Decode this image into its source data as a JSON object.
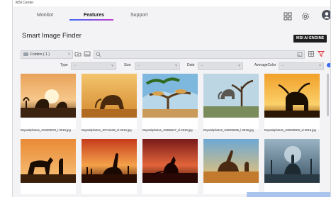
{
  "window": {
    "title": "MSI Center"
  },
  "tabs": [
    {
      "label": "Monitor"
    },
    {
      "label": "Features"
    },
    {
      "label": "Support"
    }
  ],
  "page": {
    "title": "Smart Image Finder",
    "engine_badge": "MSI AI ENGINE"
  },
  "toolbar": {
    "folder_label": "Folders ( 1 )",
    "folder_caret": "˅"
  },
  "filters": {
    "type_label": "Type",
    "type_value": "--",
    "size_label": "Size",
    "size_value": "--",
    "date_label": "Date",
    "date_value": "--",
    "color_label": "AverageColor",
    "color_value": "--",
    "caret": "˅"
  },
  "images": [
    {
      "filename": "Depositphotos_101005070_l-2015.jpg",
      "icon": "elephants-sunset"
    },
    {
      "filename": "Depositphotos_10714108_xl-2015.jpg",
      "icon": "elephant-golden"
    },
    {
      "filename": "Depositphotos_10656647_xl-2015.jpg",
      "icon": "cheetahs-tree"
    },
    {
      "filename": "Depositphotos_100006296_l-2015.jpg",
      "icon": "elephant-tree"
    },
    {
      "filename": "Depositphotos_100030302_xl-2015.jpg",
      "icon": "bull-silhouette"
    },
    {
      "filename": "",
      "icon": "horse-rider"
    },
    {
      "filename": "",
      "icon": "dinosaur-sunset"
    },
    {
      "filename": "",
      "icon": "kangaroo-sunset"
    },
    {
      "filename": "",
      "icon": "dinosaur-sky"
    },
    {
      "filename": "",
      "icon": "fantasy-rider"
    }
  ],
  "colors": {
    "accent": "#3b6cf6",
    "badge_bg": "#1e1e1e",
    "filter_active": "#e0242c"
  }
}
